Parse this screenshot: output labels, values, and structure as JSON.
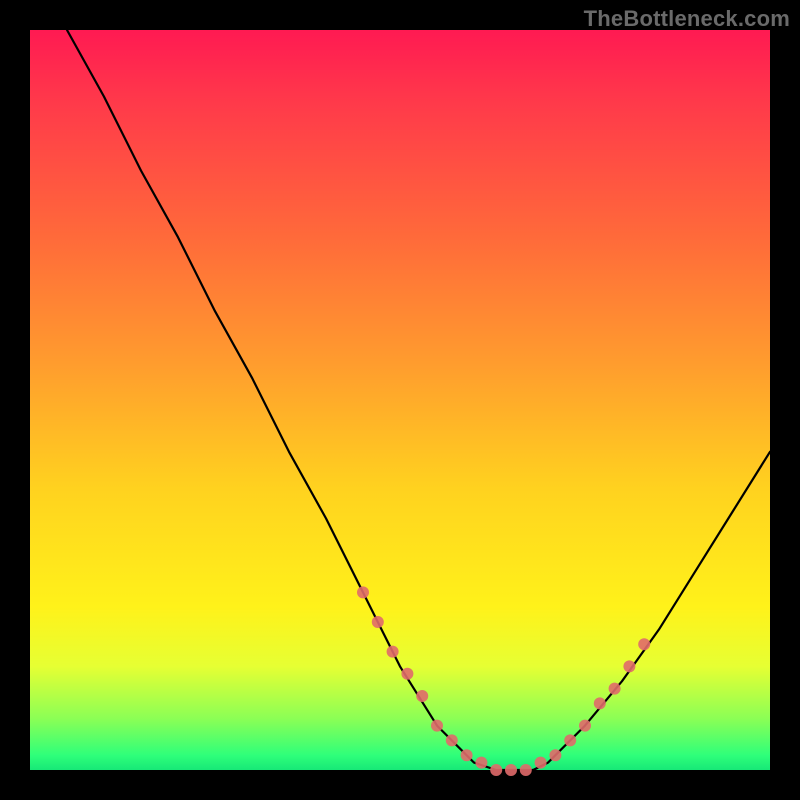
{
  "watermark": "TheBottleneck.com",
  "chart_data": {
    "type": "line",
    "title": "",
    "xlabel": "",
    "ylabel": "",
    "xlim": [
      0,
      100
    ],
    "ylim": [
      0,
      100
    ],
    "series": [
      {
        "name": "bottleneck-curve",
        "x": [
          5,
          10,
          15,
          20,
          25,
          30,
          35,
          40,
          45,
          50,
          55,
          58,
          60,
          63,
          65,
          68,
          70,
          72,
          75,
          80,
          85,
          90,
          95,
          100
        ],
        "values": [
          100,
          91,
          81,
          72,
          62,
          53,
          43,
          34,
          24,
          14,
          6,
          3,
          1,
          0,
          0,
          0,
          1,
          3,
          6,
          12,
          19,
          27,
          35,
          43
        ]
      }
    ],
    "markers": {
      "name": "highlight-dots",
      "color": "#e06a6a",
      "x": [
        45,
        47,
        49,
        51,
        53,
        55,
        57,
        59,
        61,
        63,
        65,
        67,
        69,
        71,
        73,
        75,
        77,
        79,
        81,
        83
      ],
      "values": [
        24,
        20,
        16,
        13,
        10,
        6,
        4,
        2,
        1,
        0,
        0,
        0,
        1,
        2,
        4,
        6,
        9,
        11,
        14,
        17
      ]
    },
    "gradient_stops": [
      {
        "pos": 0,
        "color": "#ff1a52"
      },
      {
        "pos": 45,
        "color": "#ff9c2e"
      },
      {
        "pos": 78,
        "color": "#fff21a"
      },
      {
        "pos": 100,
        "color": "#17e877"
      }
    ]
  }
}
